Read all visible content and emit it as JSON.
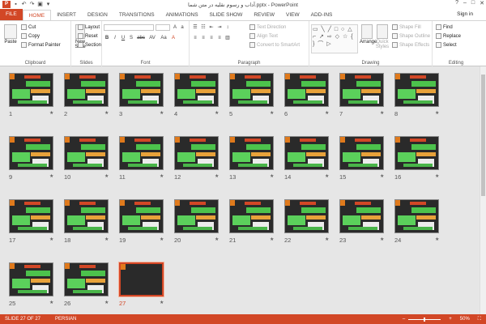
{
  "window": {
    "title": "آداب و رسوم نقلیه در متن شما.pptx - PowerPoint",
    "logo": "P",
    "minimize": "–",
    "restore": "□",
    "close": "✕",
    "help": "?"
  },
  "tabs": [
    "FILE",
    "HOME",
    "INSERT",
    "DESIGN",
    "TRANSITIONS",
    "ANIMATIONS",
    "SLIDE SHOW",
    "REVIEW",
    "VIEW",
    "ADD-INS"
  ],
  "signin": "Sign in",
  "ribbon": {
    "clipboard": {
      "label": "Clipboard",
      "paste": "Paste",
      "cut": "Cut",
      "copy": "Copy",
      "format_painter": "Format Painter"
    },
    "slides": {
      "label": "Slides",
      "new_slide": "New Slide",
      "layout": "Layout",
      "reset": "Reset",
      "section": "Section"
    },
    "font": {
      "label": "Font",
      "buttons": [
        "B",
        "I",
        "U",
        "S",
        "abc",
        "AV",
        "Aa",
        "A"
      ]
    },
    "paragraph": {
      "label": "Paragraph",
      "text_direction": "Text Direction",
      "align_text": "Align Text",
      "convert": "Convert to SmartArt"
    },
    "drawing": {
      "label": "Drawing",
      "arrange": "Arrange",
      "quick_styles": "Quick Styles",
      "shape_fill": "Shape Fill",
      "shape_outline": "Shape Outline",
      "shape_effects": "Shape Effects",
      "shapes_glyphs": "▭ ╲ ╱ □ ○ △ ⌐ ↗ ⇨ ◇ ☆ { } ⌒ ▷"
    },
    "editing": {
      "label": "Editing",
      "find": "Find",
      "replace": "Replace",
      "select": "Select"
    }
  },
  "slides": [
    "1",
    "2",
    "3",
    "4",
    "5",
    "6",
    "7",
    "8",
    "9",
    "10",
    "11",
    "12",
    "13",
    "14",
    "15",
    "16",
    "17",
    "18",
    "19",
    "20",
    "21",
    "22",
    "23",
    "24",
    "25",
    "26",
    "27"
  ],
  "star": "★",
  "status": {
    "slide": "SLIDE 27 OF 27",
    "language": "PERSIAN",
    "zoom": "50%",
    "zoom_minus": "–",
    "zoom_plus": "+"
  }
}
